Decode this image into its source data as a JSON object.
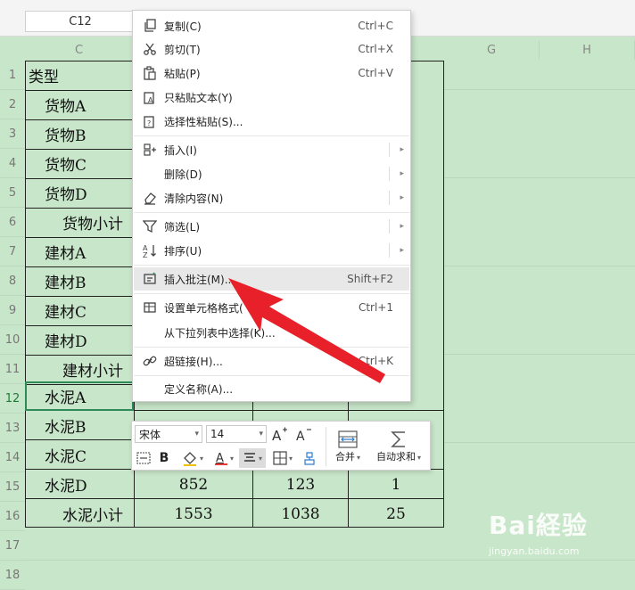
{
  "name_box": "C12",
  "columns": [
    "C",
    "G",
    "H"
  ],
  "rows": [
    "1",
    "2",
    "3",
    "4",
    "5",
    "6",
    "7",
    "8",
    "9",
    "10",
    "11",
    "12",
    "13",
    "14",
    "15",
    "16",
    "17",
    "18"
  ],
  "cells": {
    "r1": "类型",
    "r2": "货物A",
    "r3": "货物B",
    "r4": "货物C",
    "r5": "货物D",
    "r6": "货物小计",
    "r7": "建材A",
    "r8": "建材B",
    "r9": "建材C",
    "r10": "建材D",
    "r11": "建材小计",
    "r12": "水泥A",
    "r13": "水泥B",
    "r14": "水泥C",
    "r15": "水泥D",
    "r16": "水泥小计"
  },
  "values": {
    "r15": [
      "852",
      "123",
      "1"
    ],
    "r16": [
      "1553",
      "1038",
      "25"
    ]
  },
  "context_menu": {
    "copy": {
      "label": "复制(C)",
      "shortcut": "Ctrl+C"
    },
    "cut": {
      "label": "剪切(T)",
      "shortcut": "Ctrl+X"
    },
    "paste": {
      "label": "粘贴(P)",
      "shortcut": "Ctrl+V"
    },
    "paste_text": {
      "label": "只粘贴文本(Y)"
    },
    "paste_special": {
      "label": "选择性粘贴(S)..."
    },
    "insert": {
      "label": "插入(I)"
    },
    "delete": {
      "label": "删除(D)"
    },
    "clear": {
      "label": "清除内容(N)"
    },
    "filter": {
      "label": "筛选(L)"
    },
    "sort": {
      "label": "排序(U)"
    },
    "insert_comment": {
      "label": "插入批注(M)...",
      "shortcut": "Shift+F2"
    },
    "format_cells": {
      "label": "设置单元格格式(",
      "shortcut": "Ctrl+1"
    },
    "pick_list": {
      "label": "从下拉列表中选择(K)..."
    },
    "hyperlink": {
      "label": "超链接(H)...",
      "shortcut": "Ctrl+K"
    },
    "define_name": {
      "label": "定义名称(A)..."
    }
  },
  "mini_toolbar": {
    "font": "宋体",
    "size": "14",
    "merge_label": "合并",
    "autosum_label": "自动求和"
  },
  "watermark": {
    "logo": "Bai経验",
    "url": "jingyan.baidu.com"
  },
  "colors": {
    "sheet_bg": "#c8e6c9",
    "selection": "#2e8b57",
    "arrow": "#e8202a"
  }
}
